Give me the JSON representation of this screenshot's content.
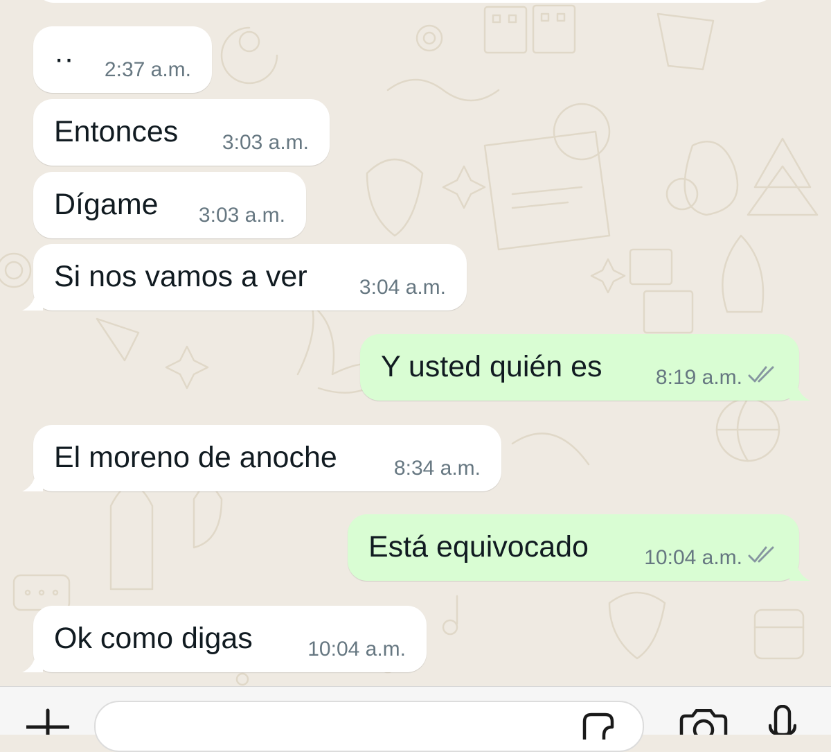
{
  "chat": {
    "messages": [
      {
        "direction": "incoming",
        "text": "··",
        "time": "2:37 a.m."
      },
      {
        "direction": "incoming",
        "text": "Entonces",
        "time": "3:03 a.m."
      },
      {
        "direction": "incoming",
        "text": "Dígame",
        "time": "3:03 a.m."
      },
      {
        "direction": "incoming",
        "text": "Si nos vamos a ver",
        "time": "3:04 a.m."
      },
      {
        "direction": "outgoing",
        "text": "Y usted quién es",
        "time": "8:19 a.m.",
        "status": "read"
      },
      {
        "direction": "incoming",
        "text": "El moreno de anoche",
        "time": "8:34 a.m."
      },
      {
        "direction": "outgoing",
        "text": "Está equivocado",
        "time": "10:04 a.m.",
        "status": "read"
      },
      {
        "direction": "incoming",
        "text": "Ok como digas",
        "time": "10:04 a.m."
      }
    ]
  },
  "composer": {
    "icons": [
      "plus-icon",
      "sticker-icon",
      "camera-icon",
      "microphone-icon"
    ]
  },
  "colors": {
    "background": "#efeae2",
    "incoming_bubble": "#ffffff",
    "outgoing_bubble": "#d9fdd3",
    "time_text": "#667781",
    "read_ticks": "#8696a0"
  }
}
